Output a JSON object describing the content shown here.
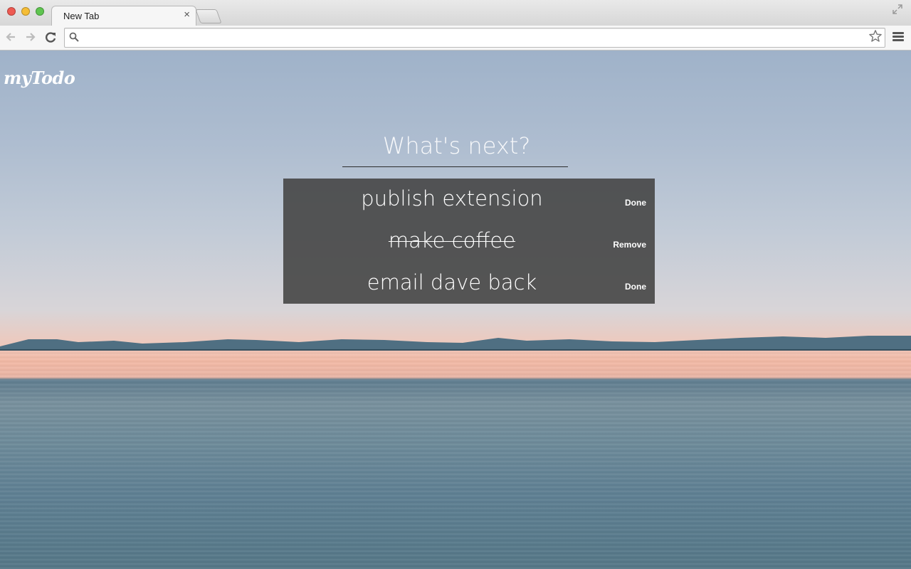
{
  "browser": {
    "tab_title": "New Tab",
    "tab_close": "×",
    "omnibox_value": "",
    "omnibox_placeholder": "",
    "icons": {
      "back": "arrow-left-icon",
      "forward": "arrow-right-icon",
      "reload": "reload-icon",
      "search": "search-icon",
      "bookmark": "star-icon",
      "menu": "hamburger-menu-icon",
      "fullscreen": "fullscreen-icon"
    }
  },
  "app": {
    "logo": "myTodo",
    "prompt_placeholder": "What's next?",
    "todos": [
      {
        "text": "publish extension",
        "completed": false,
        "action": "Done"
      },
      {
        "text": "make coffee",
        "completed": true,
        "action": "Remove"
      },
      {
        "text": "email dave back",
        "completed": false,
        "action": "Done"
      }
    ]
  },
  "colors": {
    "panel": "#464646",
    "text": "#ffffff",
    "underline": "#2b2b2b"
  }
}
